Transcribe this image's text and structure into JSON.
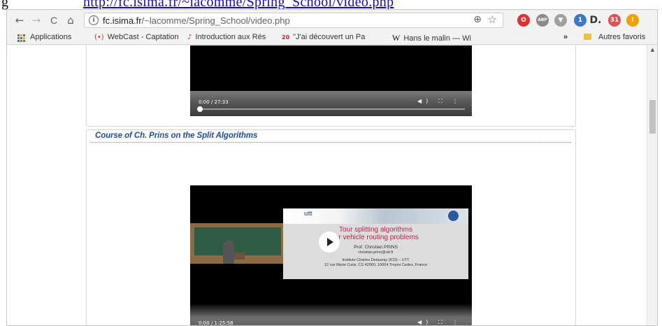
{
  "doc": {
    "left_glyph": "g",
    "link_text": "http://fc.isima.fr/~lacomme/Spring_School/video.php"
  },
  "browser": {
    "nav": {
      "back": "←",
      "forward": "→",
      "reload": "C",
      "home": "⌂"
    },
    "url_host": "fc.isima.fr",
    "url_path": "/~lacomme/Spring_School/video.php",
    "info_symbol": "i",
    "zoom_symbol": "⊕",
    "star_symbol": "☆",
    "extensions": [
      {
        "name": "opera-icon",
        "label": "O",
        "color": "#e03030"
      },
      {
        "name": "abp-icon",
        "label": "ABP",
        "color": "#8a8a8a"
      },
      {
        "name": "pocket-icon",
        "label": "▼",
        "color": "#a0a0a0"
      },
      {
        "name": "puzzle-badge-icon",
        "label": "1",
        "color": "#3a78c8"
      },
      {
        "name": "d-icon",
        "label": "D.",
        "color": "#333333"
      },
      {
        "name": "calendar-icon",
        "label": "31",
        "color": "#e05050"
      },
      {
        "name": "alert-icon",
        "label": "!",
        "color": "#f0a000"
      }
    ],
    "bookmarks": [
      {
        "label": "Applications",
        "icon": "apps-icon"
      },
      {
        "label": "WebCast - Captation",
        "icon": "(•)"
      },
      {
        "label": "Introduction aux Rés",
        "icon": "♪"
      },
      {
        "label": "\"J'ai découvert un Pa",
        "icon": "20"
      },
      {
        "label": "Hans le malin — Wi",
        "icon": "W"
      }
    ],
    "bookmarks_more": "»",
    "other_bookmarks": "Autres favoris"
  },
  "page": {
    "video1": {
      "time": "0:00 / 27:33"
    },
    "section_title": "Course of Ch. Prins on the Split Algorithms",
    "video2": {
      "time": "0:00 / 1:25:58",
      "slide_brand": "utt",
      "slide_title_1": "Tour splitting algorithms",
      "slide_title_2": "for vehicle routing problems",
      "slide_author": "Prof. Christian PRINS",
      "slide_email": "christian.prins@utt.fr",
      "slide_inst": "Institute Charles Delaunay (ICD) – UTT",
      "slide_addr": "12 rue Marie Curie, CS 42060, 10004 Troyes Cedex, France"
    },
    "controls": {
      "volume": "◀)",
      "fullscreen": "⛶",
      "menu": "⋮"
    }
  }
}
